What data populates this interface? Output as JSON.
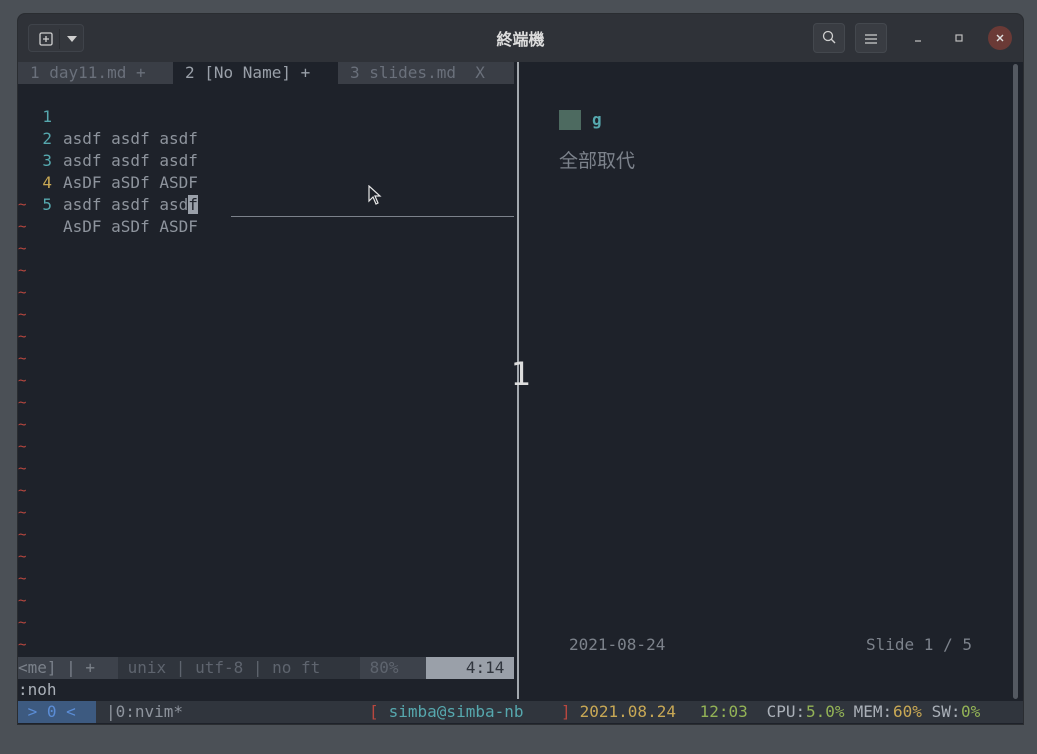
{
  "window": {
    "title": "終端機"
  },
  "tabs": [
    {
      "label": "1 day11.md + "
    },
    {
      "label": "2 [No Name] + "
    },
    {
      "label": "3 slides.md  X"
    }
  ],
  "editor": {
    "lines": [
      {
        "num": "1",
        "text": "asdf asdf asdf"
      },
      {
        "num": "2",
        "text": "asdf asdf asdf"
      },
      {
        "num": "3",
        "text": "AsDF aSDf ASDF"
      },
      {
        "num": "4",
        "text_before_cursor": "asdf asdf asd",
        "cursor_char": "f"
      },
      {
        "num": "5",
        "text": "AsDF aSDf ASDF"
      }
    ],
    "tilde": "~"
  },
  "statusline": {
    "left": "<me] | + ",
    "info": " unix | utf-8 | no ft ",
    "percent": " 80% ",
    "position": "4:14 "
  },
  "cmdline": ":noh",
  "slide": {
    "heading": "g",
    "body": "全部取代",
    "big_number": "1",
    "date": "2021-08-24",
    "page": "Slide 1 / 5"
  },
  "tmux": {
    "session": " > 0 < ",
    "window": "|0:nvim*",
    "bracket_open": "[",
    "host": " simba@simba-nb ",
    "bracket_close": "]",
    "date": " 2021.08.24",
    "time": " 12:03",
    "cpu_label": " CPU:",
    "cpu_value": "5.0%",
    "mem_label": " MEM:",
    "mem_value": "60%",
    "sw_label": " SW:",
    "sw_value": "0%"
  },
  "colors": {
    "background": "#1e222a",
    "line_number": "#56a8ae",
    "tilde": "#b8473f",
    "accent_green": "#93b356",
    "accent_yellow": "#c8a855"
  }
}
